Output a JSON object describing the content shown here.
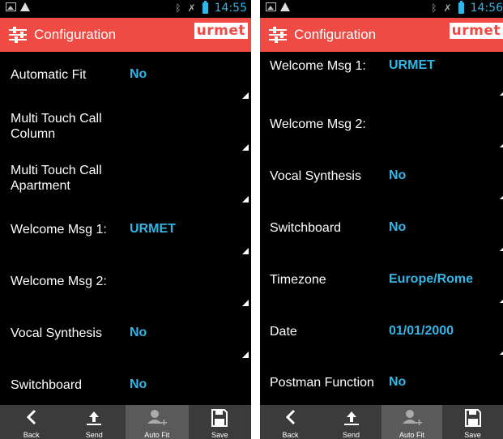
{
  "left": {
    "status": {
      "time": "14:55"
    },
    "header": {
      "title": "Configuration",
      "brand": "urmet"
    },
    "rows": [
      {
        "label": "Automatic Fit",
        "value": "No"
      },
      {
        "label": "Multi Touch Call Column",
        "value": ""
      },
      {
        "label": "Multi Touch Call Apartment",
        "value": ""
      },
      {
        "label": "Welcome Msg 1:",
        "value": "URMET"
      },
      {
        "label": "Welcome Msg 2:",
        "value": ""
      },
      {
        "label": "Vocal Synthesis",
        "value": "No"
      },
      {
        "label": "Switchboard",
        "value": "No"
      }
    ],
    "toolbar": {
      "back": "Back",
      "send": "Send",
      "autofit": "Auto Fit",
      "save": "Save"
    }
  },
  "right": {
    "status": {
      "time": "14:56"
    },
    "header": {
      "title": "Configuration",
      "brand": "urmet"
    },
    "rows": [
      {
        "label": "Welcome Msg 1:",
        "value": "URMET"
      },
      {
        "label": "Welcome Msg 2:",
        "value": ""
      },
      {
        "label": "Vocal Synthesis",
        "value": "No"
      },
      {
        "label": "Switchboard",
        "value": "No"
      },
      {
        "label": "Timezone",
        "value": "Europe/Rome"
      },
      {
        "label": "Date",
        "value": "01/01/2000"
      },
      {
        "label": "Postman Function",
        "value": "No"
      }
    ],
    "toolbar": {
      "back": "Back",
      "send": "Send",
      "autofit": "Auto Fit",
      "save": "Save"
    }
  },
  "colors": {
    "accent": "#f04a44",
    "value": "#33b5e5",
    "toolbar": "#3b3b3b"
  },
  "icons": [
    "image-icon",
    "warning-icon",
    "bluetooth-icon",
    "mute-icon",
    "battery-icon",
    "settings-sliders-icon",
    "back-icon",
    "upload-icon",
    "add-user-icon",
    "save-icon"
  ]
}
